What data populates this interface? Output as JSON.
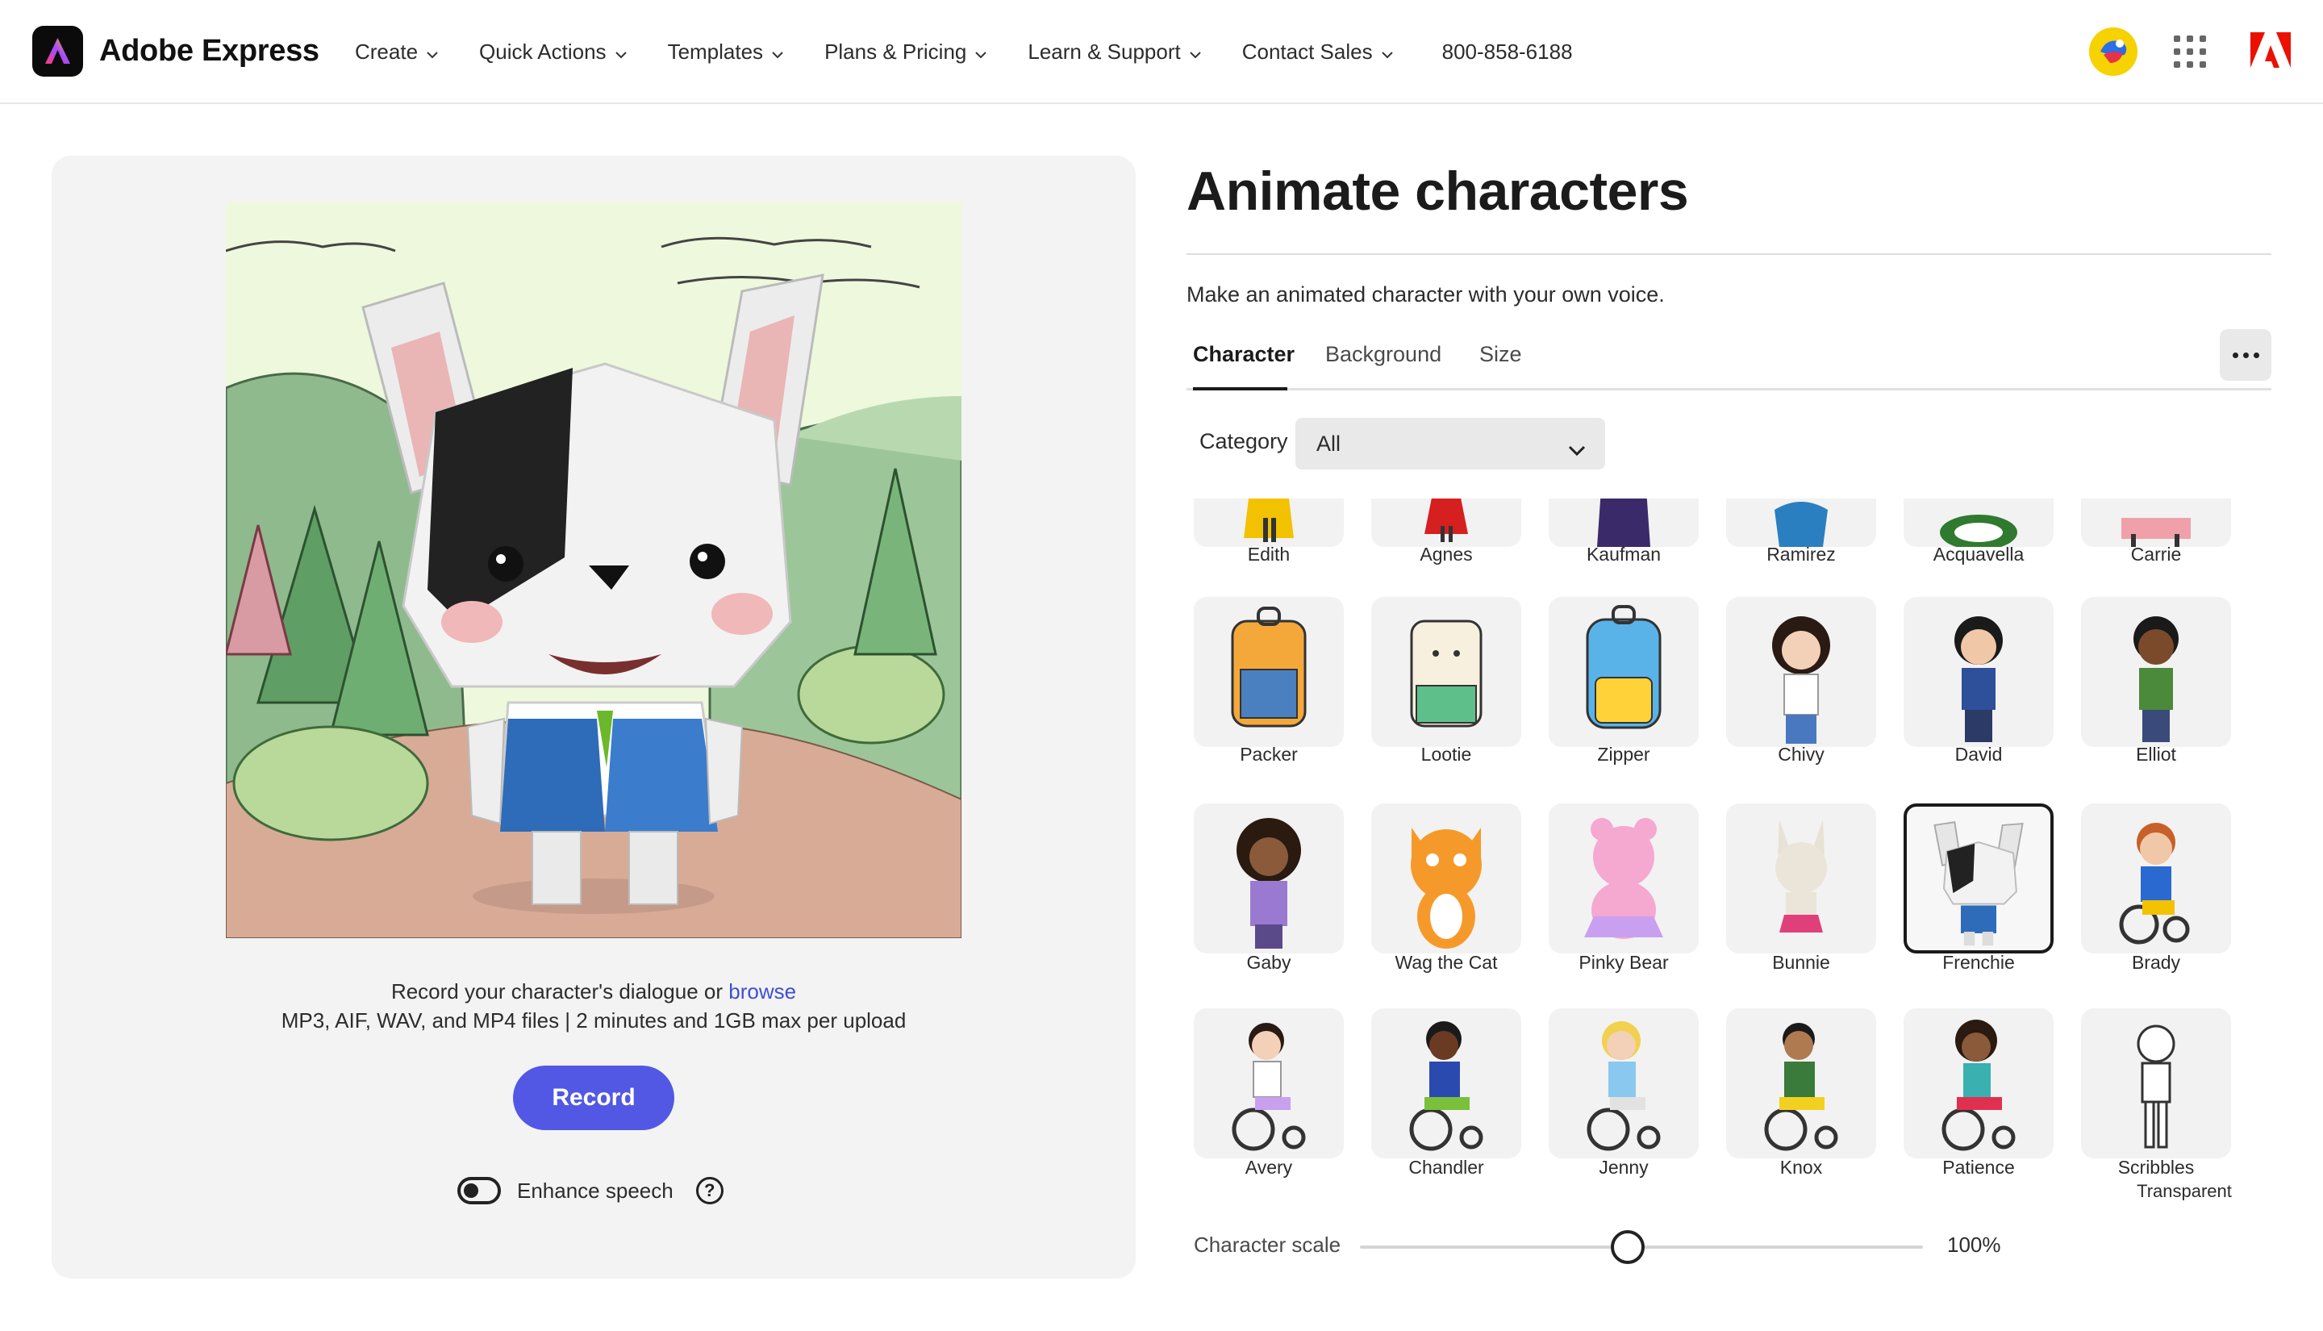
{
  "header": {
    "brand": "Adobe Express",
    "nav": [
      {
        "label": "Create",
        "icon": "chevron-down-icon"
      },
      {
        "label": "Quick Actions",
        "icon": "chevron-down-icon"
      },
      {
        "label": "Templates",
        "icon": "chevron-down-icon"
      },
      {
        "label": "Plans & Pricing",
        "icon": "chevron-down-icon"
      },
      {
        "label": "Learn & Support",
        "icon": "chevron-down-icon"
      },
      {
        "label": "Contact Sales",
        "icon": "chevron-down-icon"
      }
    ],
    "phone": "800-858-6188",
    "icons": [
      "avatar-icon",
      "apps-grid-icon",
      "adobe-logo-icon"
    ]
  },
  "left": {
    "upload_text": "Record your character's dialogue or ",
    "browse_link": "browse",
    "formats": "MP3, AIF, WAV, and MP4 files | 2 minutes and 1GB max per upload",
    "record_button": "Record",
    "enhance_label": "Enhance speech",
    "enhance_on": false
  },
  "right": {
    "title": "Animate characters",
    "subtitle": "Make an animated character with your own voice.",
    "tabs": [
      "Character",
      "Background",
      "Size"
    ],
    "active_tab": "Character",
    "category_label": "Category",
    "category_value": "All",
    "characters_row0": [
      "Edith",
      "Agnes",
      "Kaufman",
      "Ramirez",
      "Acquavella",
      "Carrie"
    ],
    "characters_row1": [
      "Packer",
      "Lootie",
      "Zipper",
      "Chivy",
      "David",
      "Elliot"
    ],
    "characters_row2": [
      "Gaby",
      "Wag the Cat",
      "Pinky Bear",
      "Bunnie",
      "Frenchie",
      "Brady"
    ],
    "characters_row3": [
      "Avery",
      "Chandler",
      "Jenny",
      "Knox",
      "Patience",
      "Scribbles"
    ],
    "selected_character": "Frenchie",
    "next_row_partial": "Transparent",
    "scale_label": "Character scale",
    "scale_value": "100%",
    "scale_percent": 100
  }
}
